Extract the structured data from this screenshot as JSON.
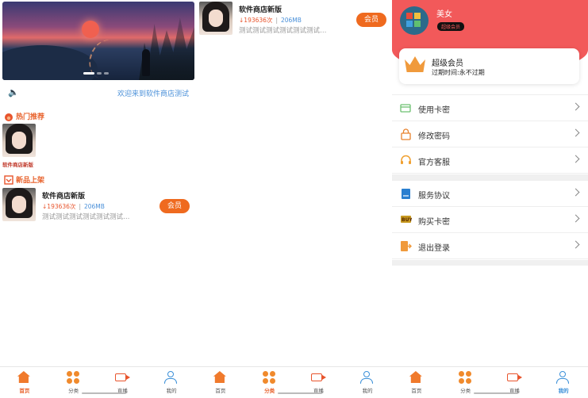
{
  "notice": {
    "text": "欢迎来到软件商店测试"
  },
  "sections": {
    "hot": "热门推荐",
    "new": "新品上架"
  },
  "hot_items": [
    {
      "caption": "软件商店新版"
    }
  ],
  "app": {
    "name": "软件商店新版",
    "downloads": "193636次",
    "size": "206MB",
    "desc": "测试测试测试测试测试测试…",
    "vip_label": "会员"
  },
  "profile": {
    "username": "美女",
    "badge": "超级会员",
    "vip_title": "超级会员",
    "vip_expire": "过期时间:永不过期",
    "menu_group1": [
      {
        "label": "使用卡密",
        "icon": "card-icon"
      },
      {
        "label": "修改密码",
        "icon": "lock-icon"
      },
      {
        "label": "官方客服",
        "icon": "headset-icon"
      }
    ],
    "menu_group2": [
      {
        "label": "服务协议",
        "icon": "document-icon"
      },
      {
        "label": "购买卡密",
        "icon": "buy-icon"
      },
      {
        "label": "退出登录",
        "icon": "logout-icon"
      }
    ]
  },
  "tabs": [
    {
      "label": "首页",
      "icon": "home-icon"
    },
    {
      "label": "分类",
      "icon": "category-icon"
    },
    {
      "label": "直播",
      "icon": "live-icon"
    },
    {
      "label": "我的",
      "icon": "profile-icon"
    }
  ],
  "colors": {
    "accent": "#ef6a1f",
    "profile_header": "#f2595a",
    "link_blue": "#4a90d9"
  }
}
